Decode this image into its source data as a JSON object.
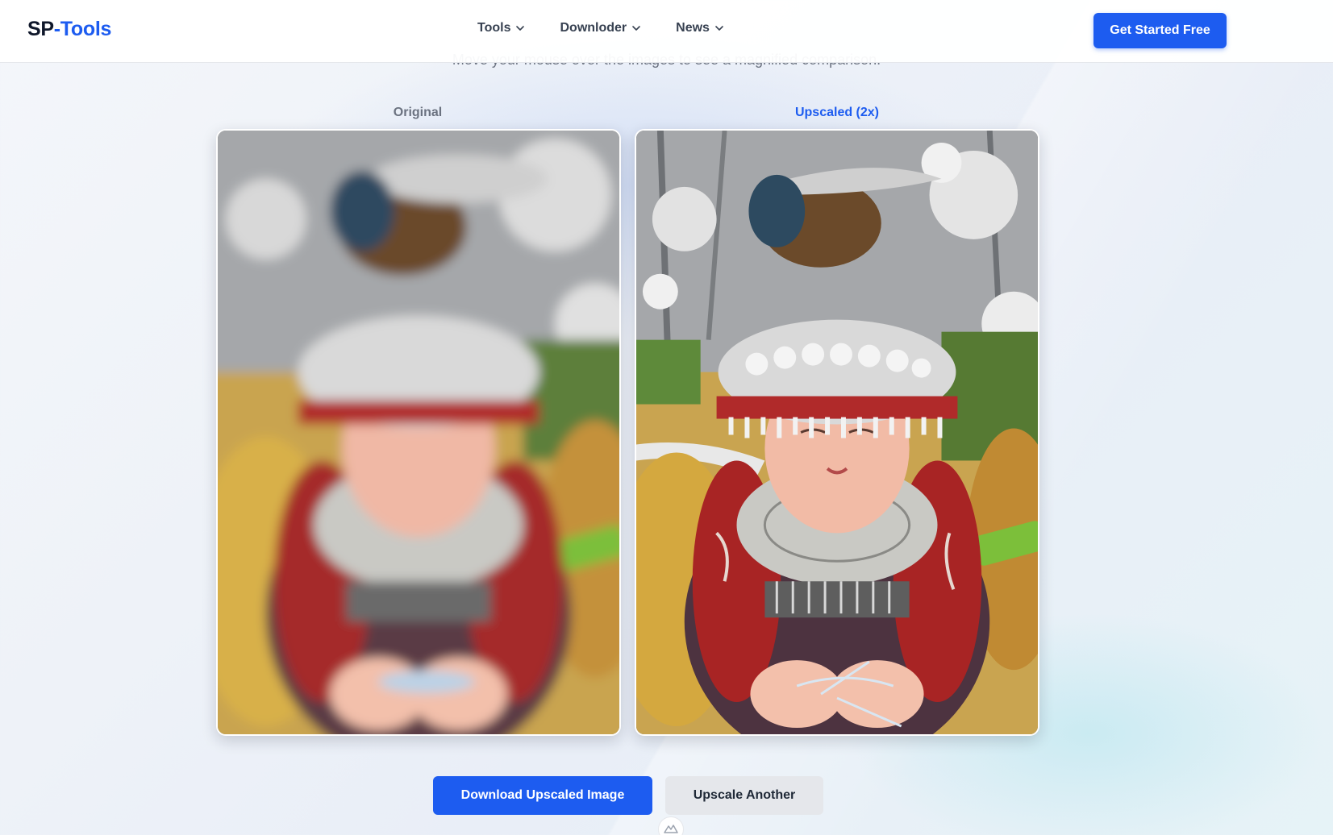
{
  "brand": {
    "prefix": "SP",
    "separator": "-",
    "suffix": "Tools"
  },
  "nav": {
    "items": [
      {
        "label": "Tools"
      },
      {
        "label": "Downloder"
      },
      {
        "label": "News"
      }
    ],
    "cta": "Get Started Free"
  },
  "main": {
    "subtitle": "Move your mouse over the images to see a magnified comparison.",
    "original_label": "Original",
    "upscaled_label": "Upscaled (2x)",
    "download_button": "Download Upscaled Image",
    "again_button": "Upscale Another"
  },
  "colors": {
    "accent": "#1d5cf0",
    "logo_dark": "#0f172a",
    "label_muted": "#6b7280"
  },
  "icons": {
    "nav_chevron": "chevron-down-icon",
    "floating": "mountain-icon"
  }
}
